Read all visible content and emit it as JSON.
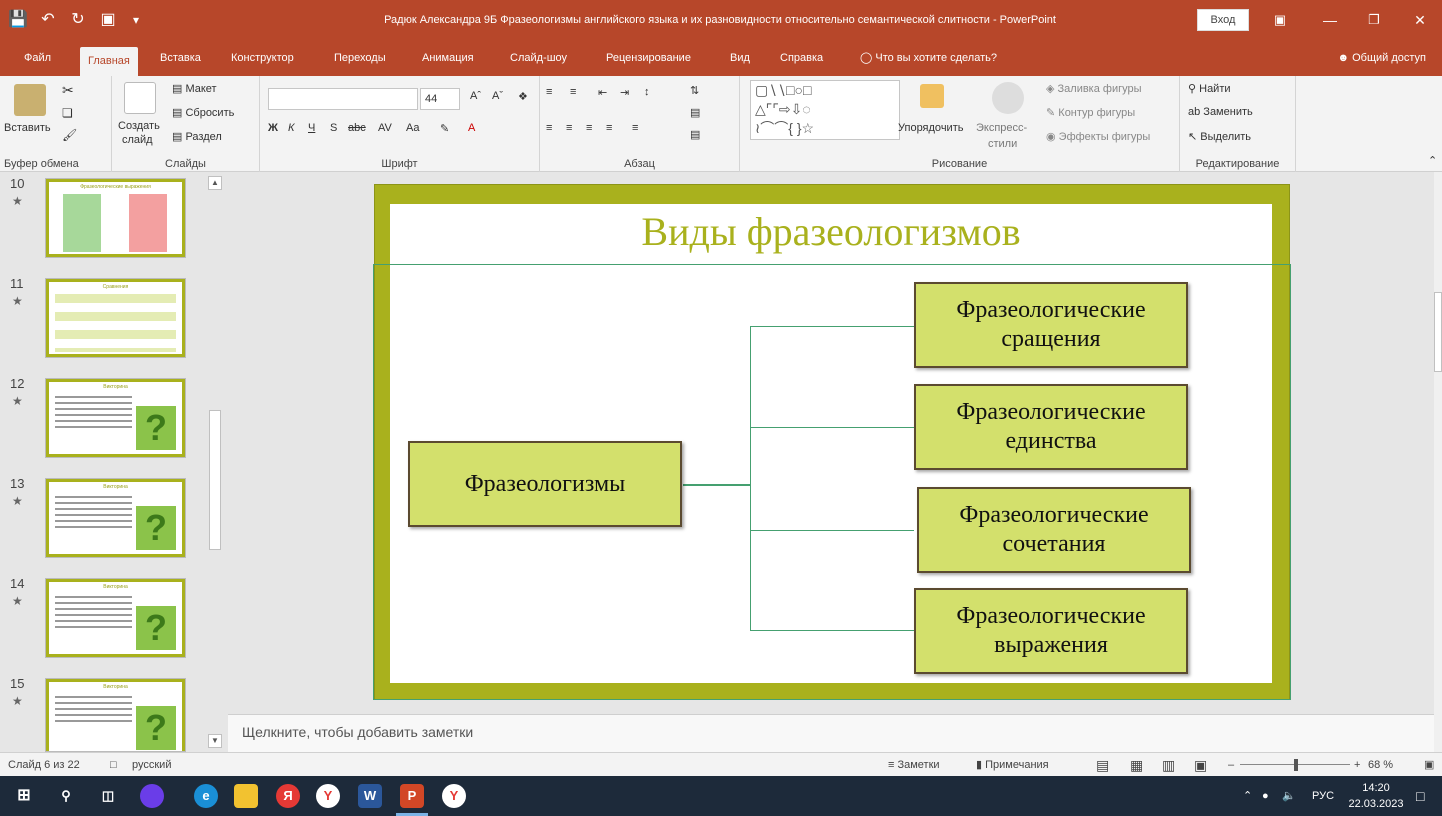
{
  "window": {
    "title": "Радюк Александра 9Б Фразеологизмы английского языка и их разновидности относительно семантической слитности  -  PowerPoint",
    "signin_label": "Вход"
  },
  "tabs": [
    {
      "label": "Файл"
    },
    {
      "label": "Главная"
    },
    {
      "label": "Вставка"
    },
    {
      "label": "Конструктор"
    },
    {
      "label": "Переходы"
    },
    {
      "label": "Анимация"
    },
    {
      "label": "Слайд-шоу"
    },
    {
      "label": "Рецензирование"
    },
    {
      "label": "Вид"
    },
    {
      "label": "Справка"
    },
    {
      "label": "Что вы хотите сделать?"
    }
  ],
  "share_label": "Общий доступ",
  "ribbon": {
    "clipboard": {
      "paste": "Вставить",
      "group": "Буфер обмена"
    },
    "slides": {
      "create": "Создать",
      "create2": "слайд",
      "layout": "Макет",
      "reset": "Сбросить",
      "section": "Раздел",
      "group": "Слайды"
    },
    "font": {
      "size": "44",
      "group": "Шрифт"
    },
    "paragraph": {
      "group": "Абзац"
    },
    "drawing": {
      "arrange": "Упорядочить",
      "quick_styles": "Экспресс-",
      "quick_styles2": "стили",
      "fill": "Заливка фигуры",
      "outline": "Контур фигуры",
      "effects": "Эффекты фигуры",
      "group": "Рисование"
    },
    "editing": {
      "find": "Найти",
      "replace": "Заменить",
      "select": "Выделить",
      "group": "Редактирование"
    }
  },
  "thumbnails": [
    {
      "num": "10",
      "title": "Фразеологические выражения"
    },
    {
      "num": "11",
      "title": "Сравнения"
    },
    {
      "num": "12",
      "title": "Викторина"
    },
    {
      "num": "13",
      "title": "Викторина"
    },
    {
      "num": "14",
      "title": "Викторина"
    },
    {
      "num": "15",
      "title": "Викторина"
    }
  ],
  "slide": {
    "title": "Виды фразеологизмов",
    "root": "Фразеологизмы",
    "branches": [
      {
        "line1": "Фразеологические",
        "line2": "сращения"
      },
      {
        "line1": "Фразеологические",
        "line2": "единства"
      },
      {
        "line1": "Фразеологические",
        "line2": "сочетания"
      },
      {
        "line1": "Фразеологические",
        "line2": "выражения"
      }
    ]
  },
  "notes_placeholder": "Щелкните, чтобы добавить заметки",
  "status": {
    "slide_info": "Слайд 6 из 22",
    "language": "русский",
    "notes": "Заметки",
    "comments": "Примечания",
    "zoom": "68 %"
  },
  "taskbar": {
    "keyboard_lang": "РУС",
    "time": "14:20",
    "date": "22.03.2023"
  },
  "colors": {
    "accent": "#b7472a",
    "slide_frame": "#a9b11d",
    "box_fill": "#d3e06c",
    "connector": "#45a070"
  }
}
